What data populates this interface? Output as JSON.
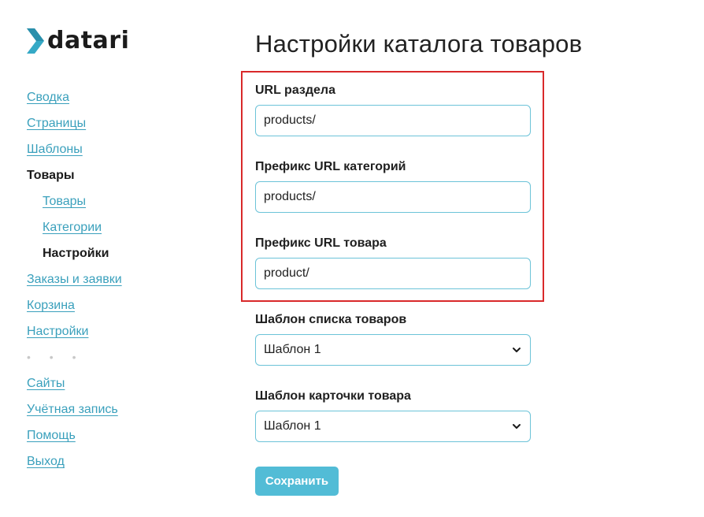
{
  "brand": {
    "name": "datari",
    "accent": "#3aa0bc",
    "logo_color": "#35a9c6"
  },
  "sidebar": {
    "items": [
      {
        "label": "Сводка",
        "active": false,
        "sub": false
      },
      {
        "label": "Страницы",
        "active": false,
        "sub": false
      },
      {
        "label": "Шаблоны",
        "active": false,
        "sub": false
      },
      {
        "label": "Товары",
        "active": true,
        "sub": false
      },
      {
        "label": "Товары",
        "active": false,
        "sub": true
      },
      {
        "label": "Категории",
        "active": false,
        "sub": true
      },
      {
        "label": "Настройки",
        "active": true,
        "sub": true
      },
      {
        "label": "Заказы и заявки",
        "active": false,
        "sub": false
      },
      {
        "label": "Корзина",
        "active": false,
        "sub": false
      },
      {
        "label": "Настройки",
        "active": false,
        "sub": false
      }
    ],
    "separator": "• • •",
    "bottom_items": [
      {
        "label": "Сайты"
      },
      {
        "label": "Учётная запись"
      },
      {
        "label": "Помощь"
      },
      {
        "label": "Выход"
      }
    ]
  },
  "main": {
    "title": "Настройки каталога товаров",
    "fields": {
      "section_url": {
        "label": "URL раздела",
        "value": "products/"
      },
      "category_prefix": {
        "label": "Префикс URL категорий",
        "value": "products/"
      },
      "product_prefix": {
        "label": "Префикс URL товара",
        "value": "product/"
      },
      "list_template": {
        "label": "Шаблон списка товаров",
        "value": "Шаблон 1"
      },
      "card_template": {
        "label": "Шаблон карточки товара",
        "value": "Шаблон 1"
      }
    },
    "save_label": "Сохранить",
    "highlight_color": "#d9292a"
  }
}
